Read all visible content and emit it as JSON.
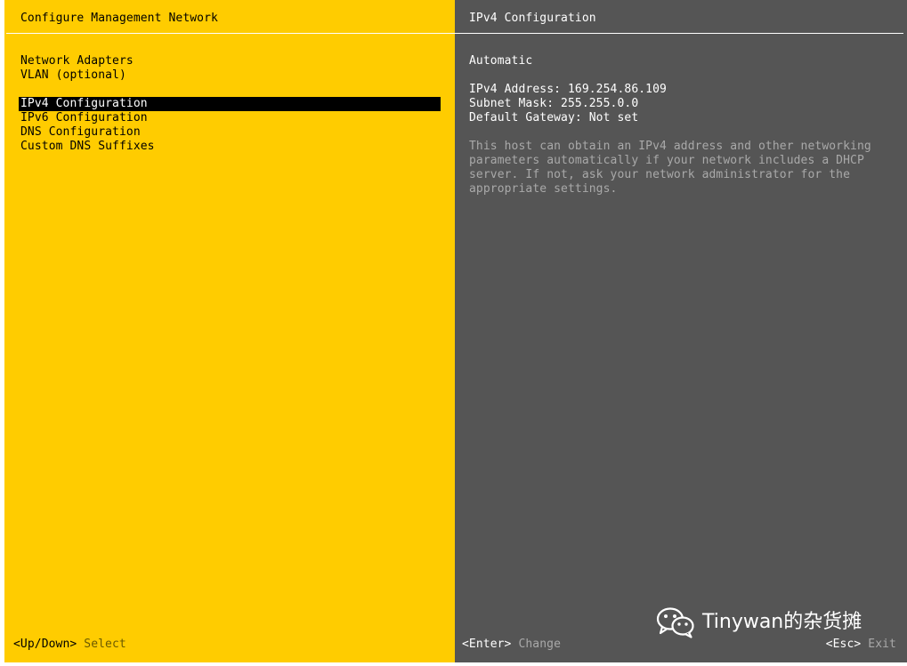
{
  "left": {
    "title": "Configure Management Network",
    "menu": [
      "Network Adapters",
      "VLAN (optional)",
      "",
      "IPv4 Configuration",
      "IPv6 Configuration",
      "DNS Configuration",
      "Custom DNS Suffixes"
    ],
    "selected_index": 3,
    "footer": {
      "key": "<Up/Down>",
      "action": "Select"
    }
  },
  "right": {
    "title": "IPv4 Configuration",
    "mode": "Automatic",
    "ipv4_address": "IPv4 Address: 169.254.86.109",
    "subnet_mask": "Subnet Mask: 255.255.0.0",
    "default_gateway": "Default Gateway: Not set",
    "description": "This host can obtain an IPv4 address and other networking parameters automatically if your network includes a DHCP server. If not, ask your network administrator for the appropriate settings.",
    "footer_change": {
      "key": "<Enter>",
      "action": "Change"
    },
    "footer_exit": {
      "key": "<Esc>",
      "action": "Exit"
    }
  },
  "watermark": {
    "text": "Tinywan的杂货摊",
    "icon": "wechat-icon"
  },
  "colors": {
    "left_bg": "#ffcc00",
    "right_bg": "#555555",
    "selection_bg": "#000000",
    "dim_text": "#a9a9a9"
  }
}
